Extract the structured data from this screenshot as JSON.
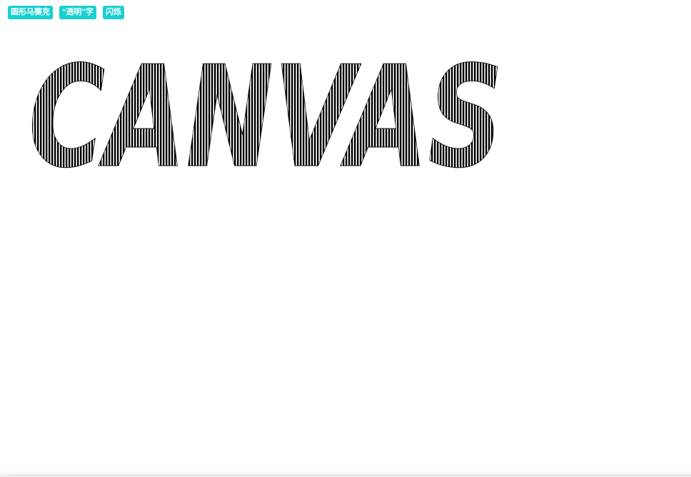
{
  "toolbar": {
    "buttons": [
      {
        "label": "圆形马赛克"
      },
      {
        "label": "“透明”字"
      },
      {
        "label": "闪烁"
      }
    ]
  },
  "canvas": {
    "text": "CANVAS",
    "mode_color": "#1a1a1a",
    "stripe_color": "#000000"
  },
  "colors": {
    "button_bg": "#17cfd1",
    "button_text": "#ffffff",
    "background": "#ffffff"
  }
}
